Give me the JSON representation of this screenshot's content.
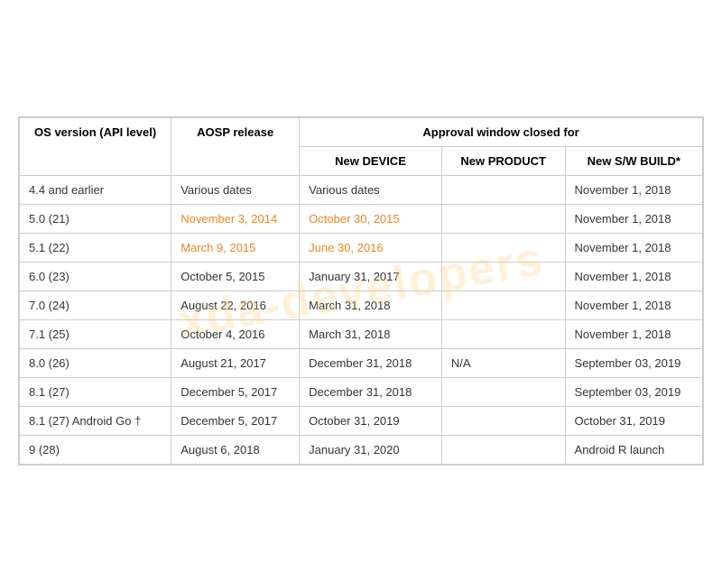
{
  "watermark": "xda-developers",
  "headers": {
    "col1": "OS version (API level)",
    "col2": "AOSP release",
    "approval": "Approval window closed for",
    "sub1": "New DEVICE",
    "sub2": "New PRODUCT",
    "sub3": "New S/W BUILD*"
  },
  "rows": [
    {
      "os": "4.4 and earlier",
      "aosp": "Various dates",
      "device": "Various dates",
      "product": "",
      "sw": "November 1, 2018"
    },
    {
      "os": "5.0 (21)",
      "aosp": "November 3, 2014",
      "device": "October 30, 2015",
      "product": "",
      "sw": "November 1, 2018"
    },
    {
      "os": "5.1 (22)",
      "aosp": "March 9, 2015",
      "device": "June 30, 2016",
      "product": "",
      "sw": "November 1, 2018"
    },
    {
      "os": "6.0 (23)",
      "aosp": "October 5, 2015",
      "device": "January 31, 2017",
      "product": "",
      "sw": "November 1, 2018"
    },
    {
      "os": "7.0 (24)",
      "aosp": "August 22, 2016",
      "device": "March 31, 2018",
      "product": "",
      "sw": "November 1, 2018"
    },
    {
      "os": "7.1 (25)",
      "aosp": "October 4, 2016",
      "device": "March 31, 2018",
      "product": "",
      "sw": "November 1, 2018"
    },
    {
      "os": "8.0 (26)",
      "aosp": "August 21, 2017",
      "device": "December 31, 2018",
      "product": "N/A",
      "sw": "September 03, 2019"
    },
    {
      "os": "8.1 (27)",
      "aosp": "December 5, 2017",
      "device": "December 31, 2018",
      "product": "",
      "sw": "September 03, 2019"
    },
    {
      "os": "8.1 (27) Android Go †",
      "aosp": "December 5, 2017",
      "device": "October 31, 2019",
      "product": "",
      "sw": "October 31, 2019"
    },
    {
      "os": "9 (28)",
      "aosp": "August 6, 2018",
      "device": "January 31, 2020",
      "product": "",
      "sw": "Android R launch"
    }
  ]
}
